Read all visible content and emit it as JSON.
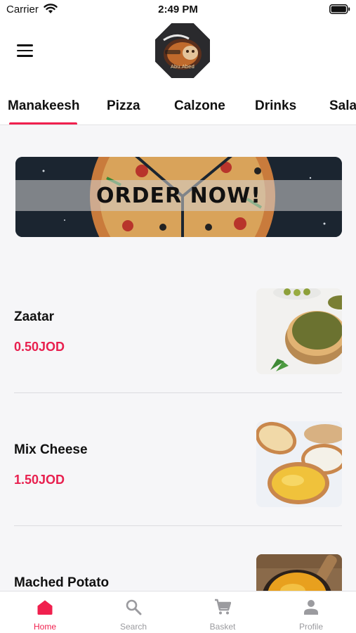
{
  "status_bar": {
    "carrier": "Carrier",
    "time": "2:49 PM"
  },
  "header": {
    "logo_icon": "abu-abed-logo"
  },
  "tabs": [
    {
      "label": "Manakeesh",
      "active": true
    },
    {
      "label": "Pizza"
    },
    {
      "label": "Calzone"
    },
    {
      "label": "Drinks"
    },
    {
      "label": "Sala"
    }
  ],
  "banner": {
    "text": "ORDER NOW!"
  },
  "items": [
    {
      "name": "Zaatar",
      "price": "0.50JOD"
    },
    {
      "name": "Mix Cheese",
      "price": "1.50JOD"
    },
    {
      "name": "Mached Potato",
      "price": ""
    }
  ],
  "bottom_nav": [
    {
      "label": "Home",
      "icon": "home-icon",
      "active": true
    },
    {
      "label": "Search",
      "icon": "search-icon"
    },
    {
      "label": "Basket",
      "icon": "cart-icon"
    },
    {
      "label": "Profile",
      "icon": "person-icon"
    }
  ],
  "colors": {
    "accent": "#f0204e",
    "price": "#e8204f",
    "inactive": "#9b9b9f"
  }
}
